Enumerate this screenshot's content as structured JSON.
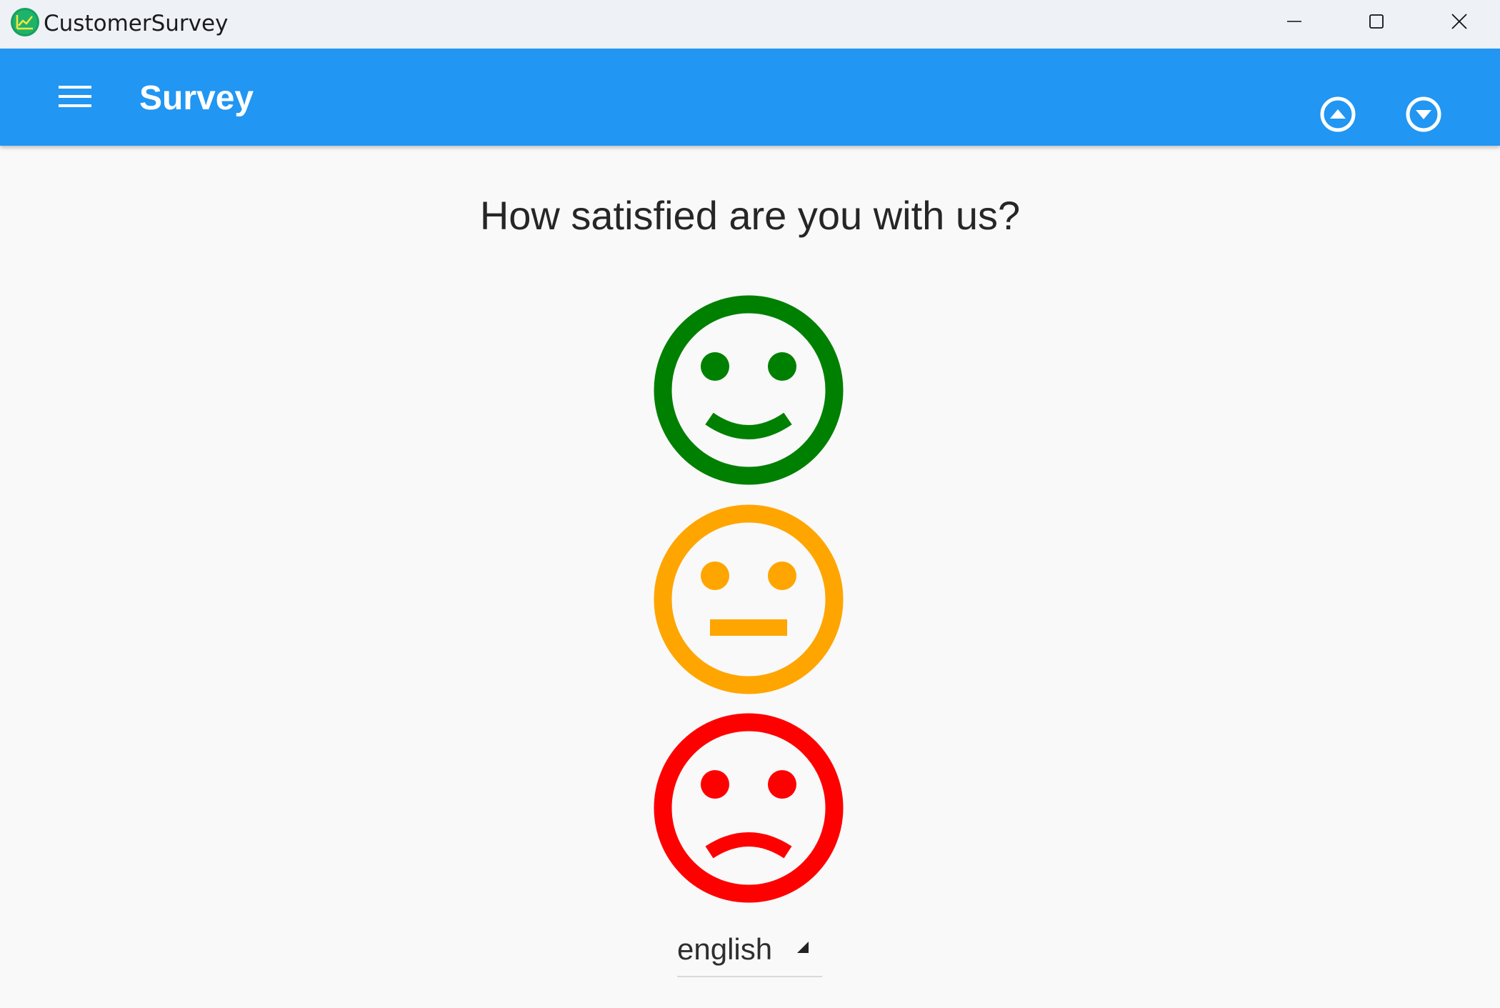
{
  "window": {
    "title": "CustomerSurvey",
    "controls": [
      "minimize",
      "maximize",
      "close"
    ]
  },
  "appbar": {
    "title": "Survey",
    "color": "#2196f3",
    "icons": [
      "menu-icon",
      "chevron-up-circle-icon",
      "chevron-down-circle-icon"
    ]
  },
  "survey": {
    "question": "How satisfied are you with us?",
    "options": [
      {
        "mood": "happy",
        "color": "#008000"
      },
      {
        "mood": "neutral",
        "color": "#ffa500"
      },
      {
        "mood": "sad",
        "color": "#ff0000"
      }
    ]
  },
  "language": {
    "selected": "english"
  }
}
